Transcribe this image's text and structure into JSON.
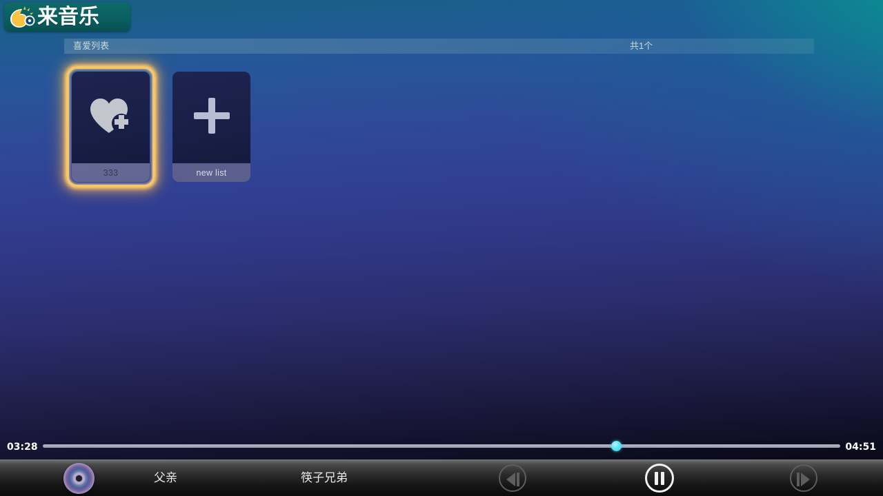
{
  "app": {
    "logo_text": "来音乐",
    "logo_icon": "moon-music-logo-icon"
  },
  "list_header": {
    "title": "喜爱列表",
    "count": "共1个"
  },
  "playlists": [
    {
      "name": "333",
      "icon": "heart-plus-icon",
      "selected": true
    },
    {
      "name": "new list",
      "icon": "plus-icon",
      "selected": false
    }
  ],
  "player": {
    "current_time": "03:28",
    "total_time": "04:51",
    "progress_percent": 71,
    "song_title": "父亲",
    "artist": "筷子兄弟",
    "album_art_icon": "cd-disc-icon",
    "prev_label": "prev-icon",
    "play_label": "pause-icon",
    "next_label": "next-icon",
    "thumb_color": "#4de2f0",
    "track_color": "#a8a8bb"
  }
}
